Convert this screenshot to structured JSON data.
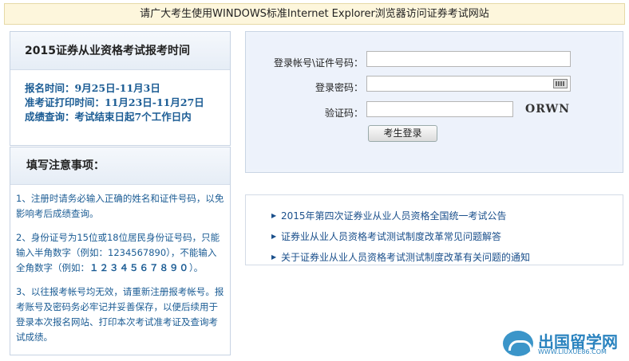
{
  "notice": "请广大考生使用WINDOWS标准Internet Explorer浏览器访问证券考试网站",
  "schedule": {
    "title": "2015证券从业资格考试报考时间",
    "lines": [
      "报名时间：9月25日-11月3日",
      "准考证打印时间：11月23日-11月27日",
      "成绩查询：考试结束日起7个工作日内"
    ]
  },
  "notes": {
    "title": "填写注意事项：",
    "items": [
      "1、注册时请务必输入正确的姓名和证件号码，以免影响考后成绩查询。",
      "2、身份证号为15位或18位居民身份证号码，只能输入半角数字（例如：1234567890），不能输入全角数字（例如：",
      "１２３４５６７８９０",
      "）。",
      "3、以往报考帐号均无效，请重新注册报考帐号。报考账号及密码务必牢记并妥善保存，以便后续用于登录本次报名网站、打印本次考试准考证及查询考试成绩。"
    ]
  },
  "login": {
    "account_label": "登录帐号\\证件号码：",
    "account_value": "",
    "password_label": "登录密码：",
    "password_value": "",
    "captcha_label": "验证码：",
    "captcha_value": "",
    "captcha_text": "ORWN",
    "submit_label": "考生登录"
  },
  "links": [
    "2015年第四次证券业从业人员资格全国统一考试公告",
    "证券业从业人员资格考试测试制度改革常见问题解答",
    "关于证券业从业人员资格考试测试制度改革有关问题的通知"
  ],
  "watermark": {
    "title": "出国留学网",
    "url": "WWW.LIUXUE86.COM"
  }
}
